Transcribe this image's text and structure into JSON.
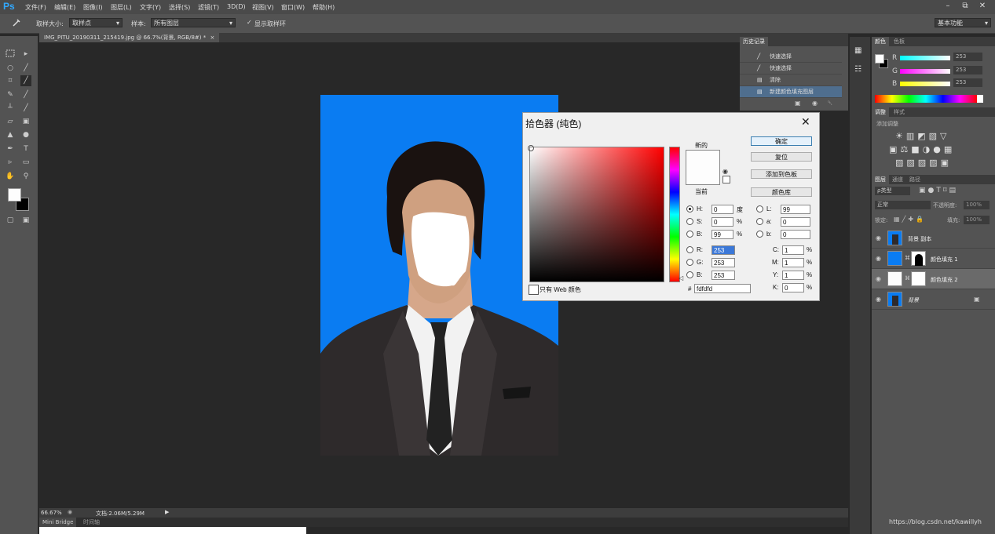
{
  "app": {
    "logo": "Ps"
  },
  "menu": [
    "文件(F)",
    "编辑(E)",
    "图像(I)",
    "图层(L)",
    "文字(Y)",
    "选择(S)",
    "滤镜(T)",
    "3D(D)",
    "视图(V)",
    "窗口(W)",
    "帮助(H)"
  ],
  "window_buttons": {
    "minimize": "–",
    "restore": "⧉",
    "close": "✕"
  },
  "options": {
    "sample_size_label": "取样大小:",
    "sample_size_value": "取样点",
    "sample_label": "样本:",
    "sample_value": "所有图层",
    "show_ring_label": "显示取样环",
    "workspace": "基本功能"
  },
  "document": {
    "tab_title": "IMG_PITU_20190311_215419.jpg @ 66.7%(背景, RGB/8#) *",
    "close": "×"
  },
  "status": {
    "zoom": "66.67%",
    "doc_size": "文档:2.06M/5.29M"
  },
  "bottom_tabs": [
    "Mini Bridge",
    "时间轴"
  ],
  "history": {
    "tab": "历史记录",
    "items": [
      {
        "label": "快速选择",
        "icon": "brush-icon"
      },
      {
        "label": "快速选择",
        "icon": "brush-icon"
      },
      {
        "label": "清除",
        "icon": "doc-icon"
      },
      {
        "label": "新建颜色填充图层",
        "icon": "doc-icon"
      }
    ]
  },
  "color_panel": {
    "tabs": [
      "颜色",
      "色板"
    ],
    "channels": [
      {
        "label": "R",
        "value": "253"
      },
      {
        "label": "G",
        "value": "253"
      },
      {
        "label": "B",
        "value": "253"
      }
    ]
  },
  "adjustments": {
    "tabs": [
      "调整",
      "样式"
    ],
    "hint": "添加调整"
  },
  "layers_panel": {
    "tabs": [
      "图层",
      "通道",
      "路径"
    ],
    "filter_kind": "ρ类型",
    "blend_mode": "正常",
    "opacity_label": "不透明度:",
    "opacity_value": "100%",
    "lock_label": "锁定:",
    "fill_label": "填充:",
    "fill_value": "100%",
    "layers": [
      {
        "name": "背景 副本",
        "type": "photo"
      },
      {
        "name": "颜色填充 1",
        "type": "fill-blue"
      },
      {
        "name": "颜色填充 2",
        "type": "fill-white",
        "selected": true
      },
      {
        "name": "背景",
        "type": "photo",
        "locked": true
      }
    ]
  },
  "picker": {
    "title": "拾色器 (纯色)",
    "new_label": "新的",
    "current_label": "当前",
    "buttons": {
      "ok": "确定",
      "reset": "复位",
      "add_swatch": "添加到色板",
      "libraries": "颜色库"
    },
    "web_only": "只有 Web 颜色",
    "hsb": [
      {
        "label": "H:",
        "value": "0",
        "unit": "度",
        "selected": true
      },
      {
        "label": "S:",
        "value": "0",
        "unit": "%"
      },
      {
        "label": "B:",
        "value": "99",
        "unit": "%"
      }
    ],
    "rgb": [
      {
        "label": "R:",
        "value": "253"
      },
      {
        "label": "G:",
        "value": "253"
      },
      {
        "label": "B:",
        "value": "253"
      }
    ],
    "lab": [
      {
        "label": "L:",
        "value": "99"
      },
      {
        "label": "a:",
        "value": "0"
      },
      {
        "label": "b:",
        "value": "0"
      }
    ],
    "cmyk": [
      {
        "label": "C:",
        "value": "1",
        "unit": "%"
      },
      {
        "label": "M:",
        "value": "1",
        "unit": "%"
      },
      {
        "label": "Y:",
        "value": "1",
        "unit": "%"
      },
      {
        "label": "K:",
        "value": "0",
        "unit": "%"
      }
    ],
    "hex_label": "#",
    "hex_value": "fdfdfd",
    "new_color": "#fdfdfd",
    "current_color": "#fdfdfd"
  },
  "watermark": "https://blog.csdn.net/kawillyh",
  "canvas_bg": "#0a7cf2"
}
